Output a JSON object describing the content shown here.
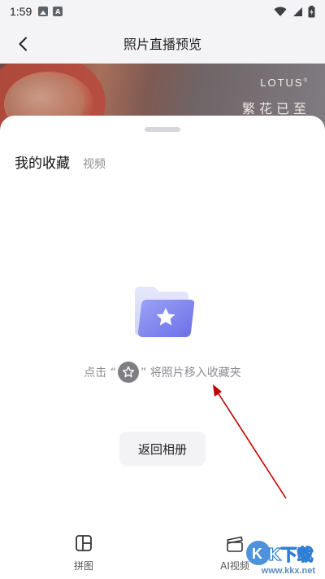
{
  "status_bar": {
    "time": "1:59"
  },
  "header": {
    "title": "照片直播预览"
  },
  "banner": {
    "brand": "LOTUS",
    "tagline": "繁花已至"
  },
  "sheet": {
    "tabs": [
      {
        "label": "我的收藏",
        "active": true
      },
      {
        "label": "视频",
        "active": false
      }
    ],
    "empty_hint_prefix": "点击 “",
    "empty_hint_suffix": "” 将照片移入收藏夹",
    "return_button": "返回相册"
  },
  "bottom_toolbar": [
    {
      "label": "拼图",
      "icon": "collage-icon"
    },
    {
      "label": "AI视频",
      "icon": "ai-video-icon"
    }
  ],
  "watermark": {
    "logo_text": "KK下载",
    "domain": "www.kkx.net"
  },
  "colors": {
    "accent": "#7b7ff0",
    "annotation": "#c00000",
    "text_muted": "#8d8d93"
  }
}
